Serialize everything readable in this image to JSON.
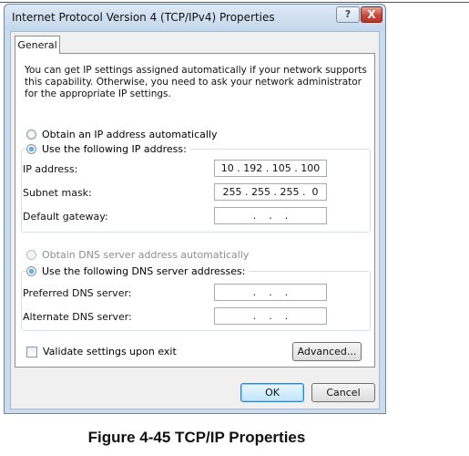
{
  "window": {
    "title": "Internet Protocol Version 4 (TCP/IPv4) Properties",
    "help_glyph": "?",
    "close_glyph": "X"
  },
  "tabs": [
    {
      "label": "General",
      "active": true
    }
  ],
  "description": "You can get IP settings assigned automatically if your network supports this capability. Otherwise, you need to ask your network administrator for the appropriate IP settings.",
  "ip_section": {
    "auto_label": "Obtain an IP address automatically",
    "auto_selected": false,
    "manual_label": "Use the following IP address:",
    "manual_selected": true,
    "fields": [
      {
        "label": "IP address:",
        "value": "10 . 192 . 105 . 100"
      },
      {
        "label": "Subnet mask:",
        "value": "255 . 255 . 255 .  0"
      },
      {
        "label": "Default gateway:",
        "value": ".    .    ."
      }
    ]
  },
  "dns_section": {
    "auto_label": "Obtain DNS server address automatically",
    "auto_selected": false,
    "auto_disabled": true,
    "manual_label": "Use the following DNS server addresses:",
    "manual_selected": true,
    "fields": [
      {
        "label": "Preferred DNS server:",
        "value": ".    .    ."
      },
      {
        "label": "Alternate DNS server:",
        "value": ".    .    ."
      }
    ]
  },
  "validate_label": "Validate settings upon exit",
  "validate_checked": false,
  "buttons": {
    "advanced": "Advanced...",
    "ok": "OK",
    "cancel": "Cancel"
  },
  "caption": "Figure 4-45  TCP/IP Properties",
  "colors": {
    "title_bar": "#c9dcee",
    "close_button": "#c7463a",
    "dialog_body": "#f0f0f0"
  }
}
